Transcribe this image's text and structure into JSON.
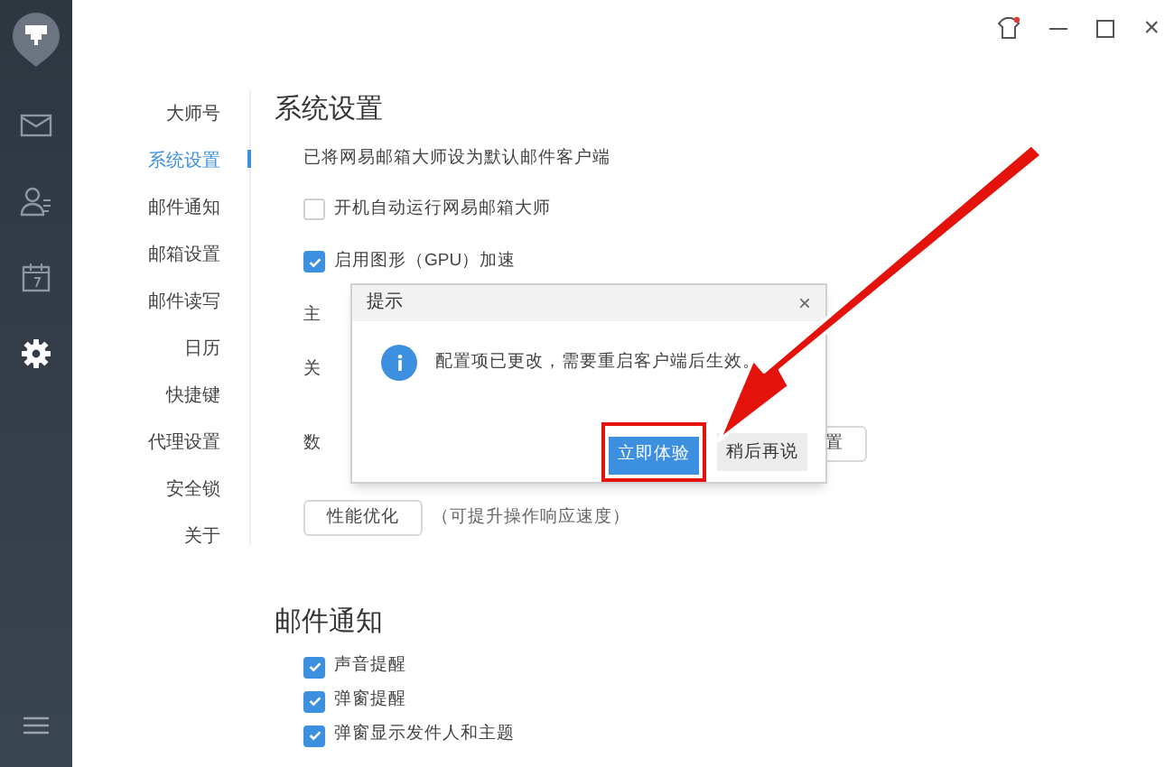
{
  "nav_rail": {
    "items": [
      {
        "kind": "mail",
        "selected": false
      },
      {
        "kind": "contacts",
        "selected": false
      },
      {
        "kind": "calendar",
        "selected": false
      },
      {
        "kind": "settings",
        "selected": true
      }
    ]
  },
  "settings_nav": [
    {
      "label": "大师号",
      "selected": false
    },
    {
      "label": "系统设置",
      "selected": true
    },
    {
      "label": "邮件通知",
      "selected": false
    },
    {
      "label": "邮箱设置",
      "selected": false
    },
    {
      "label": "邮件读写",
      "selected": false
    },
    {
      "label": "日历",
      "selected": false
    },
    {
      "label": "快捷键",
      "selected": false
    },
    {
      "label": "代理设置",
      "selected": false
    },
    {
      "label": "安全锁",
      "selected": false
    },
    {
      "label": "关于",
      "selected": false
    }
  ],
  "system_settings": {
    "title": "系统设置",
    "rows": [
      {
        "kind": "text",
        "text": "已将网易邮箱大师设为默认邮件客户端"
      },
      {
        "kind": "checkbox",
        "label": "开机自动运行网易邮箱大师",
        "checked": false
      },
      {
        "kind": "checkbox",
        "label": "启用图形（GPU）加速",
        "checked": true
      },
      {
        "kind": "text",
        "text": "主"
      },
      {
        "kind": "text",
        "text": "关"
      },
      {
        "kind": "partial",
        "text": "数",
        "button": "置"
      },
      {
        "kind": "button",
        "button": "性能优化",
        "note": "（可提升操作响应速度）"
      }
    ]
  },
  "mail_notifications": {
    "title": "邮件通知",
    "rows": [
      {
        "label": "声音提醒",
        "checked": true
      },
      {
        "label": "弹窗提醒",
        "checked": true
      },
      {
        "label": "弹窗显示发件人和主题",
        "checked": true
      }
    ]
  },
  "dialog": {
    "title": "提示",
    "close": "×",
    "message": "配置项已更改，需要重启客户端后生效。",
    "buttons": [
      {
        "label": "立即体验",
        "primary": true,
        "highlighted": true
      },
      {
        "label": "稍后再说",
        "primary": false,
        "highlighted": false
      }
    ]
  },
  "window_controls": {
    "close": "×"
  }
}
